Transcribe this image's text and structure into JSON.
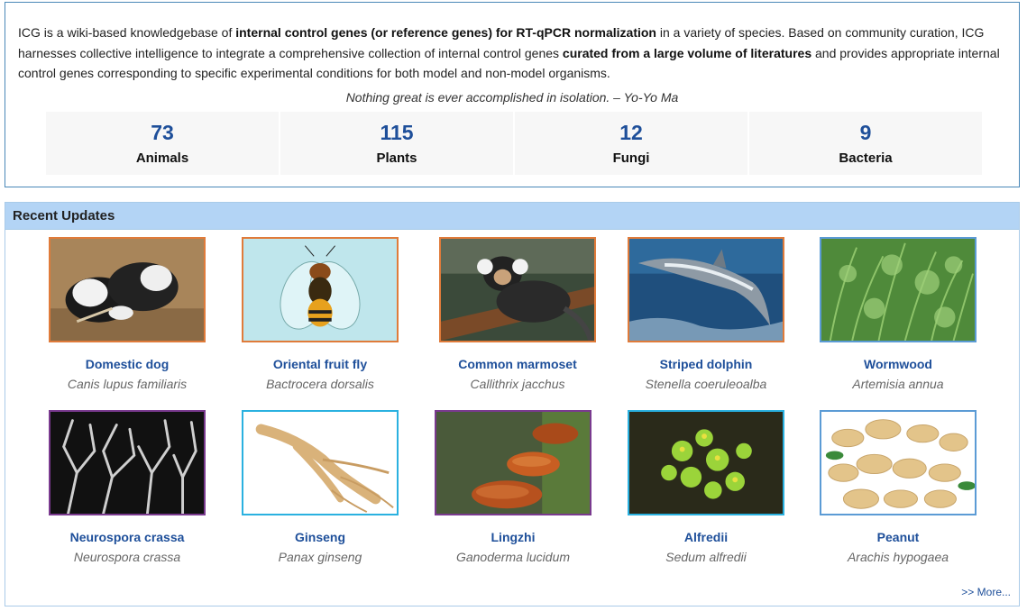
{
  "intro": {
    "p1": "ICG is a wiki-based knowledgebase of ",
    "b1": "internal control genes (or reference genes) for RT-qPCR normalization",
    "p2": " in a variety of species. Based on community curation, ICG harnesses collective intelligence to integrate a comprehensive collection of internal control genes ",
    "b2": "curated from a large volume of literatures",
    "p3": " and provides appropriate internal control genes corresponding to specific experimental conditions for both model and non-model organisms.",
    "quote": "Nothing great is ever accomplished in isolation. – Yo-Yo Ma"
  },
  "stats": [
    {
      "value": "73",
      "label": "Animals"
    },
    {
      "value": "115",
      "label": "Plants"
    },
    {
      "value": "12",
      "label": "Fungi"
    },
    {
      "value": "9",
      "label": "Bacteria"
    }
  ],
  "updates": {
    "title": "Recent Updates",
    "more": ">> More...",
    "items": [
      {
        "common": "Domestic dog",
        "scientific": "Canis lupus familiaris"
      },
      {
        "common": "Oriental fruit fly",
        "scientific": "Bactrocera dorsalis"
      },
      {
        "common": "Common marmoset",
        "scientific": "Callithrix jacchus"
      },
      {
        "common": "Striped dolphin",
        "scientific": "Stenella coeruleoalba"
      },
      {
        "common": "Wormwood",
        "scientific": "Artemisia annua"
      },
      {
        "common": "Neurospora crassa",
        "scientific": "Neurospora crassa"
      },
      {
        "common": "Ginseng",
        "scientific": "Panax ginseng"
      },
      {
        "common": "Lingzhi",
        "scientific": "Ganoderma lucidum"
      },
      {
        "common": "Alfredii",
        "scientific": "Sedum alfredii"
      },
      {
        "common": "Peanut",
        "scientific": "Arachis hypogaea"
      }
    ]
  },
  "colors": {
    "link": "#1e4f9a",
    "header_bg": "#b3d4f5",
    "animal_border": "#e07b3a",
    "plant_border": "#5b9bd5",
    "fungi_border": "#7a3a8f",
    "ginseng_border": "#2ab1e0"
  }
}
